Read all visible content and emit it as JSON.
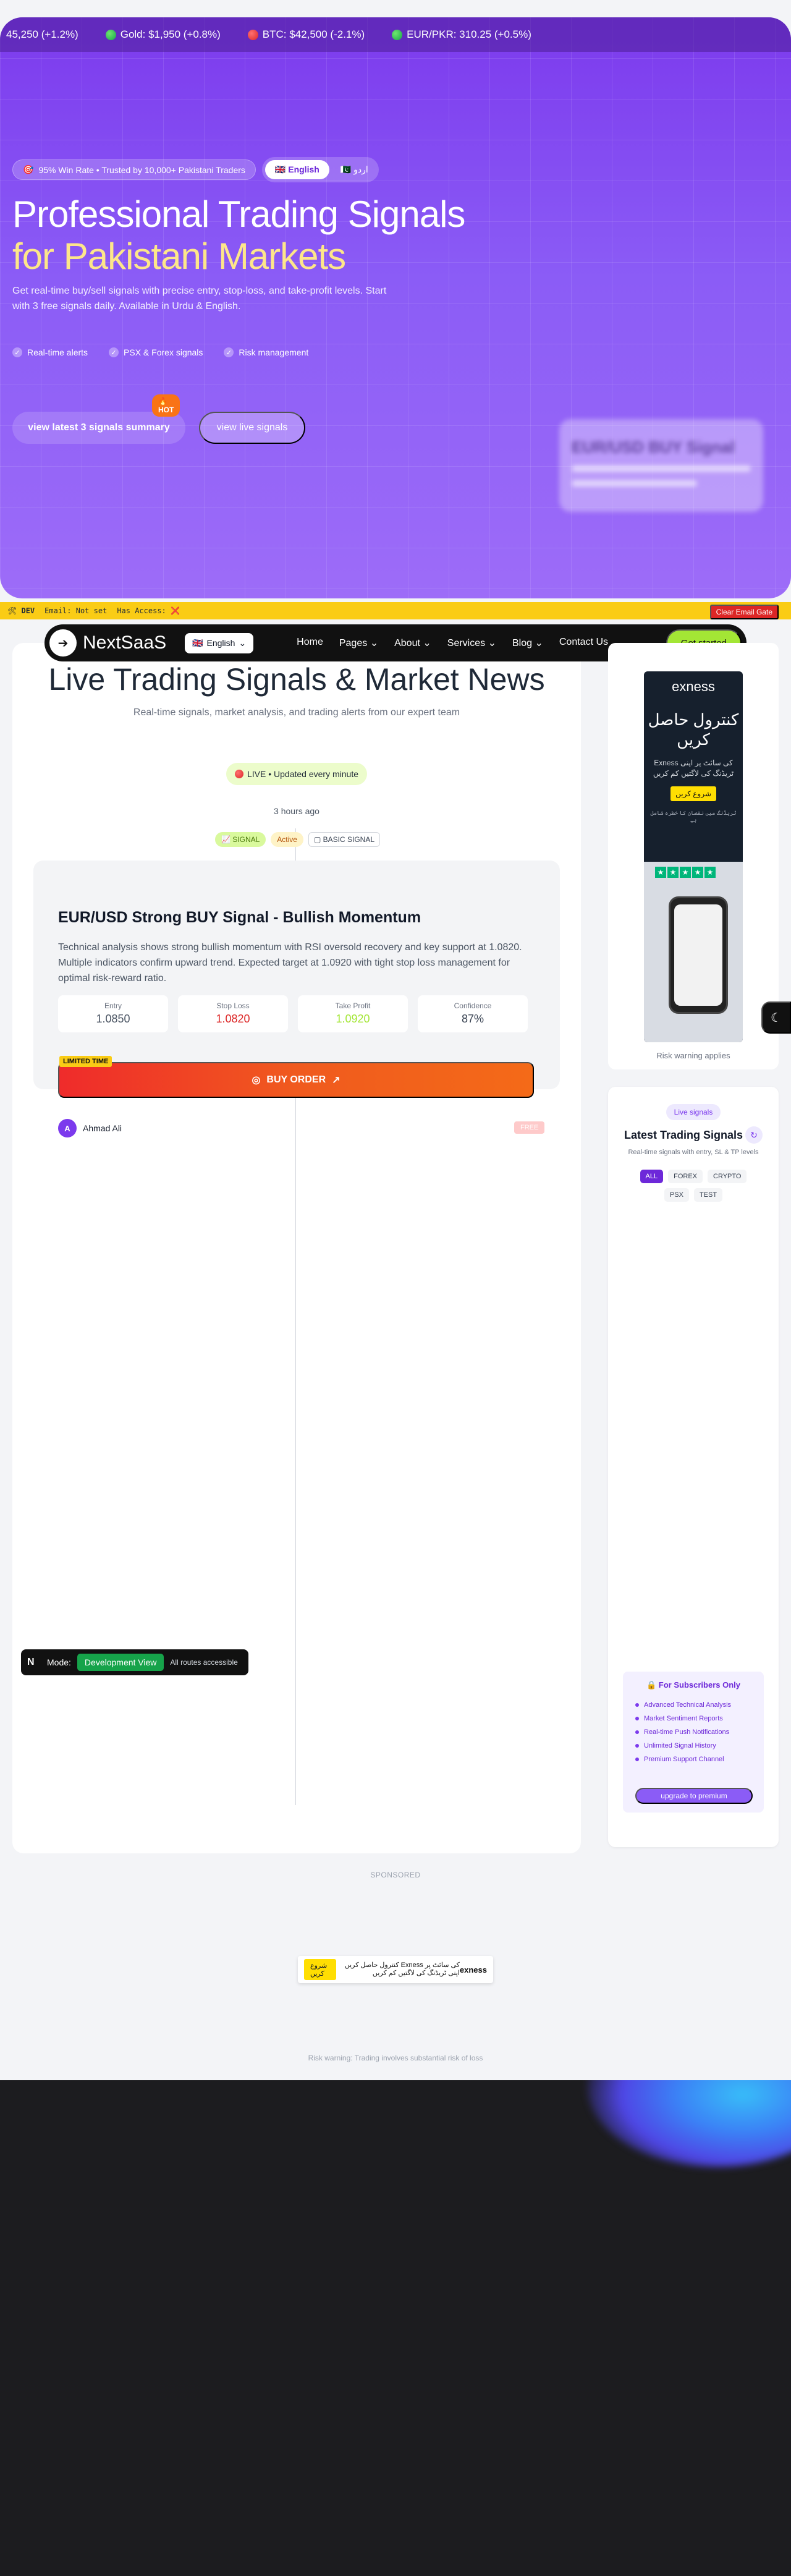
{
  "ticker": [
    {
      "text": "45,250 (+1.2%)",
      "dot": ""
    },
    {
      "text": "Gold: $1,950 (+0.8%)",
      "dot": "green"
    },
    {
      "text": "BTC: $42,500 (-2.1%)",
      "dot": "red"
    },
    {
      "text": "EUR/PKR: 310.25 (+0.5%)",
      "dot": "green"
    }
  ],
  "hero": {
    "winrate_badge": "95% Win Rate • Trusted by 10,000+ Pakistani Traders",
    "lang_active": "English",
    "lang_other": "اردو",
    "title_line1": "Professional Trading Signals",
    "title_line2": "for Pakistani Markets",
    "description": "Get real-time buy/sell signals with precise entry, stop-loss, and take-profit levels. Start with 3 free signals daily. Available in Urdu & English.",
    "features": [
      "Real-time alerts",
      "PSX & Forex signals",
      "Risk management"
    ],
    "cta_primary": "view latest 3 signals summary",
    "hot_badge": "🔥 HOT",
    "cta_secondary": "view live signals",
    "blurred_card_title": "EUR/USD BUY Signal"
  },
  "devbar": {
    "env": "DEV",
    "email": "Email: Not set",
    "access": "Has Access: ❌",
    "clear_button": "Clear Email Gate"
  },
  "nav": {
    "logo_text": "NextSaaS",
    "language": "English",
    "links": [
      "Home",
      "Pages",
      "About",
      "Services",
      "Blog",
      "Contact Us"
    ],
    "cta": "Get started"
  },
  "main": {
    "title": "Live Trading Signals & Market News",
    "subtitle": "Real-time signals, market analysis, and trading alerts from our expert team",
    "live_badge": "LIVE • Updated every minute",
    "time_ago": "3 hours ago",
    "pills": [
      "SIGNAL",
      "Active",
      "BASIC SIGNAL"
    ],
    "signal": {
      "title": "EUR/USD Strong BUY Signal - Bullish Momentum",
      "description": "Technical analysis shows strong bullish momentum with RSI oversold recovery and key support at 1.0820. Multiple indicators confirm upward trend. Expected target at 1.0920 with tight stop loss management for optimal risk-reward ratio.",
      "metrics": [
        {
          "label": "Entry",
          "value": "1.0850",
          "color": "#4b5563"
        },
        {
          "label": "Stop Loss",
          "value": "1.0820",
          "color": "#dc2626"
        },
        {
          "label": "Take Profit",
          "value": "1.0920",
          "color": "#a3e635"
        },
        {
          "label": "Confidence",
          "value": "87%",
          "color": "#374151"
        }
      ],
      "limited_label": "LIMITED TIME",
      "buy_label": "BUY ORDER",
      "author_initial": "A",
      "author_name": "Ahmad Ali",
      "tag": "FREE"
    }
  },
  "devmode": {
    "logo": "N",
    "mode_label": "Mode:",
    "mode_value": "Development View",
    "routes_note": "All routes accessible"
  },
  "sidebar_ad": {
    "brand": "exness",
    "headline": "كنترول حاصل كريں",
    "body": "Exness كى سائٹ پر اپنى ٹريڈنگ كى لاگتيں كم كريں",
    "button": "شروع كريں",
    "fine_print": "ٹريڈنگ ميں نقصان كا خطره شامل ہے",
    "risk_line": "Risk warning applies"
  },
  "signals_box": {
    "pill": "Live signals",
    "title": "Latest Trading Signals",
    "subtitle": "Real-time signals with entry, SL & TP levels",
    "filters": [
      "ALL",
      "FOREX",
      "CRYPTO",
      "PSX",
      "TEST"
    ],
    "subscribers_title": "For Subscribers Only",
    "subscriber_features": [
      "Advanced Technical Analysis",
      "Market Sentiment Reports",
      "Real-time Push Notifications",
      "Unlimited Signal History",
      "Premium Support Channel"
    ],
    "upgrade_button": "upgrade to premium"
  },
  "sponsored": {
    "label": "SPONSORED",
    "banner_button": "شروع كريں",
    "banner_text": "كنترول حاصل كريں Exness كى سائٹ پر اپنى ٹريڈنگ كى لاگتيں كم كريں",
    "banner_logo": "exness",
    "risk_warning": "Risk warning: Trading involves substantial risk of loss"
  },
  "colors": {
    "primary": "#7c3aed",
    "accent_yellow": "#fde68a",
    "lime": "#a3e635",
    "buy_red": "#ef2b2b"
  }
}
